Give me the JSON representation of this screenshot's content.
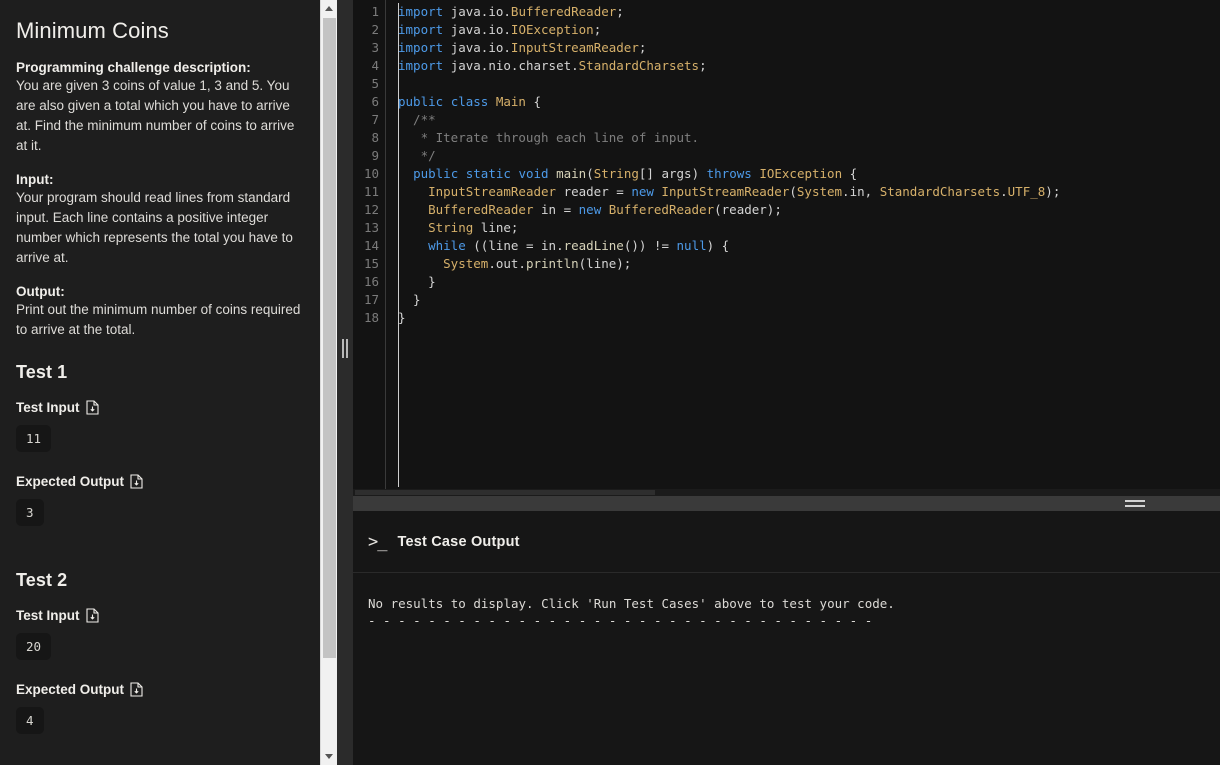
{
  "sidebar": {
    "title": "Minimum Coins",
    "sections": [
      {
        "heading": "Programming challenge description:",
        "body": "You are given 3 coins of value 1, 3 and 5. You are also given a total which you have to arrive at. Find the minimum number of coins to arrive at it."
      },
      {
        "heading": "Input:",
        "body": "Your program should read lines from standard input. Each line contains a positive integer number which represents the total you have to arrive at."
      },
      {
        "heading": "Output:",
        "body": "Print out the minimum number of coins required to arrive at the total."
      }
    ],
    "tests": [
      {
        "name": "Test 1",
        "input_label": "Test Input",
        "input_value": "11",
        "output_label": "Expected Output",
        "output_value": "3"
      },
      {
        "name": "Test 2",
        "input_label": "Test Input",
        "input_value": "20",
        "output_label": "Expected Output",
        "output_value": "4"
      }
    ],
    "download_icon": "file-download-icon"
  },
  "editor": {
    "language": "java",
    "first_line": 1,
    "line_numbers": [
      "1",
      "2",
      "3",
      "4",
      "5",
      "6",
      "7",
      "8",
      "9",
      "10",
      "11",
      "12",
      "13",
      "14",
      "15",
      "16",
      "17",
      "18"
    ],
    "lines": [
      "import java.io.BufferedReader;",
      "import java.io.IOException;",
      "import java.io.InputStreamReader;",
      "import java.nio.charset.StandardCharsets;",
      "",
      "public class Main {",
      "  /**",
      "   * Iterate through each line of input.",
      "   */",
      "  public static void main(String[] args) throws IOException {",
      "    InputStreamReader reader = new InputStreamReader(System.in, StandardCharsets.UTF_8);",
      "    BufferedReader in = new BufferedReader(reader);",
      "    String line;",
      "    while ((line = in.readLine()) != null) {",
      "      System.out.println(line);",
      "    }",
      "  }",
      "}"
    ]
  },
  "output_panel": {
    "prompt_icon": "terminal-prompt-icon",
    "title": "Test Case Output",
    "message": "No results to display. Click 'Run Test Cases' above to test your code.",
    "separator": "- - - - - - - - - - - - - - - - - - - - - - - - - - - - - - - - - -"
  },
  "colors": {
    "sidebar_bg": "#1e1e1e",
    "editor_bg": "#131313",
    "output_bg": "#161616",
    "splitter": "#3a3a3a",
    "keyword": "#4d9ae8",
    "class_name": "#d6b06a",
    "comment": "#7f7f7f",
    "text": "#d4d4d4"
  }
}
